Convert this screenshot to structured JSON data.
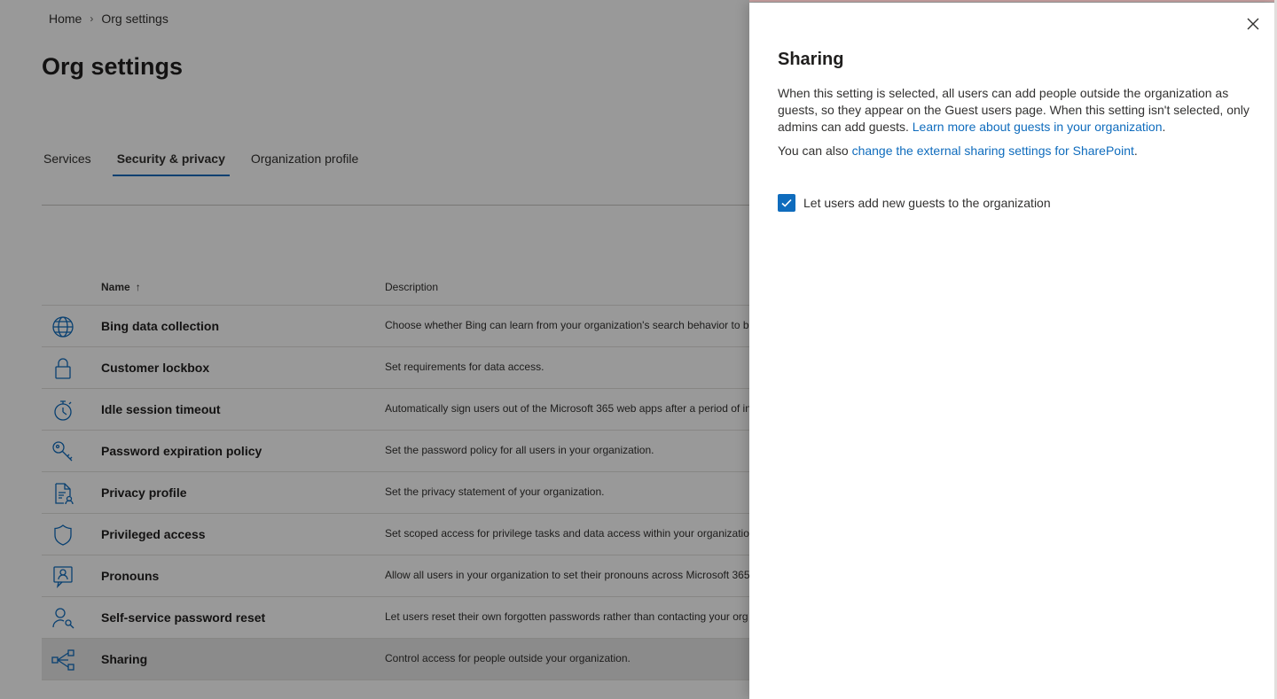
{
  "breadcrumb": {
    "home": "Home",
    "current": "Org settings"
  },
  "page": {
    "title": "Org settings"
  },
  "tabs": [
    {
      "label": "Services",
      "active": false
    },
    {
      "label": "Security & privacy",
      "active": true
    },
    {
      "label": "Organization profile",
      "active": false
    }
  ],
  "table": {
    "columns": {
      "name": "Name",
      "name_sort": "↑",
      "description": "Description"
    },
    "rows": [
      {
        "icon": "globe-icon",
        "name": "Bing data collection",
        "description": "Choose whether Bing can learn from your organization's search behavior to be"
      },
      {
        "icon": "lock-icon",
        "name": "Customer lockbox",
        "description": "Set requirements for data access."
      },
      {
        "icon": "timer-icon",
        "name": "Idle session timeout",
        "description": "Automatically sign users out of the Microsoft 365 web apps after a period of in"
      },
      {
        "icon": "key-icon",
        "name": "Password expiration policy",
        "description": "Set the password policy for all users in your organization."
      },
      {
        "icon": "document-person-icon",
        "name": "Privacy profile",
        "description": "Set the privacy statement of your organization."
      },
      {
        "icon": "shield-icon",
        "name": "Privileged access",
        "description": "Set scoped access for privilege tasks and data access within your organization"
      },
      {
        "icon": "person-card-icon",
        "name": "Pronouns",
        "description": "Allow all users in your organization to set their pronouns across Microsoft 365"
      },
      {
        "icon": "person-key-icon",
        "name": "Self-service password reset",
        "description": "Let users reset their own forgotten passwords rather than contacting your org"
      },
      {
        "icon": "share-icon",
        "name": "Sharing",
        "description": "Control access for people outside your organization."
      }
    ]
  },
  "panel": {
    "title": "Sharing",
    "paragraph1": "When this setting is selected, all users can add people outside the organization as guests, so they appear on the Guest users page. When this setting isn't selected, only admins can add guests.",
    "link1": "Learn more about guests in your organization",
    "paragraph2_prefix": "You can also",
    "link2": "change the external sharing settings for SharePoint",
    "checkbox_label": "Let users add new guests to the organization",
    "checkbox_checked": true
  },
  "colors": {
    "accent": "#0f6cbd",
    "overlay": "rgba(0,0,0,0.4)"
  }
}
